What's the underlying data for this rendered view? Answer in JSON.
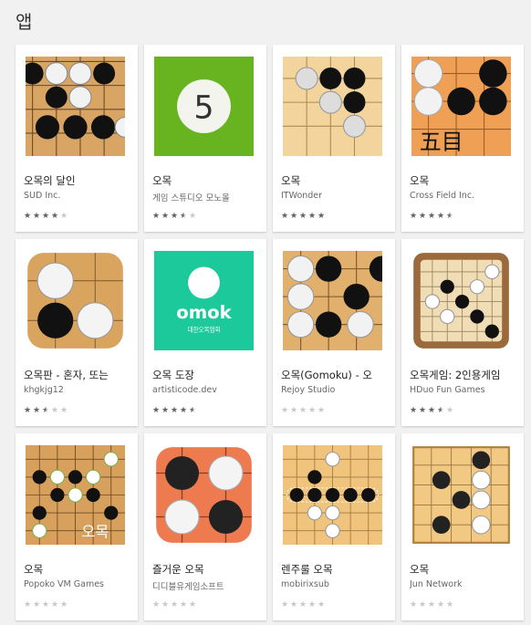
{
  "section": {
    "title": "앱"
  },
  "apps": [
    {
      "title": "오목의 달인",
      "developer": "SUD Inc.",
      "rating": 4.0,
      "icon": "gomoku-board-icon"
    },
    {
      "title": "오목",
      "developer": "게임 스튜디오 모노올",
      "rating": 3.5,
      "icon": "green-five-icon"
    },
    {
      "title": "오목",
      "developer": "ITWonder",
      "rating": 5.0,
      "icon": "gomoku-board-icon"
    },
    {
      "title": "오목",
      "developer": "Cross Field Inc.",
      "rating": 4.5,
      "icon": "gomoku-kanji-icon",
      "icon_text": "五目"
    },
    {
      "title": "오목판 - 혼자, 또는",
      "developer": "khgkjg12",
      "rating": 2.5,
      "icon": "gomoku-board-icon"
    },
    {
      "title": "오목 도장",
      "developer": "artisticode.dev",
      "rating": 4.5,
      "icon": "omok-dojang-icon",
      "icon_text": "omok",
      "icon_subtext": "대한오목협회"
    },
    {
      "title": "오목(Gomoku) - 오",
      "developer": "Rejoy Studio",
      "rating": 0,
      "icon": "gomoku-board-icon"
    },
    {
      "title": "오목게임: 2인용게임",
      "developer": "HDuo Fun Games",
      "rating": 3.5,
      "icon": "gomoku-board-icon"
    },
    {
      "title": "오목",
      "developer": "Popoko VM Games",
      "rating": 0,
      "icon": "gomoku-board-icon",
      "icon_text": "오목"
    },
    {
      "title": "즐거운 오목",
      "developer": "디디블유게임소프트",
      "rating": 0,
      "icon": "orange-stones-icon"
    },
    {
      "title": "렌주룰 오목",
      "developer": "mobirixsub",
      "rating": 0,
      "icon": "gomoku-board-icon"
    },
    {
      "title": "오목",
      "developer": "Jun Network",
      "rating": 0,
      "icon": "gomoku-board-icon"
    }
  ],
  "colors": {
    "board": "#dba662",
    "green": "#67b320",
    "teal": "#1bc99a",
    "orange": "#ee7b50",
    "star": "#616161"
  }
}
